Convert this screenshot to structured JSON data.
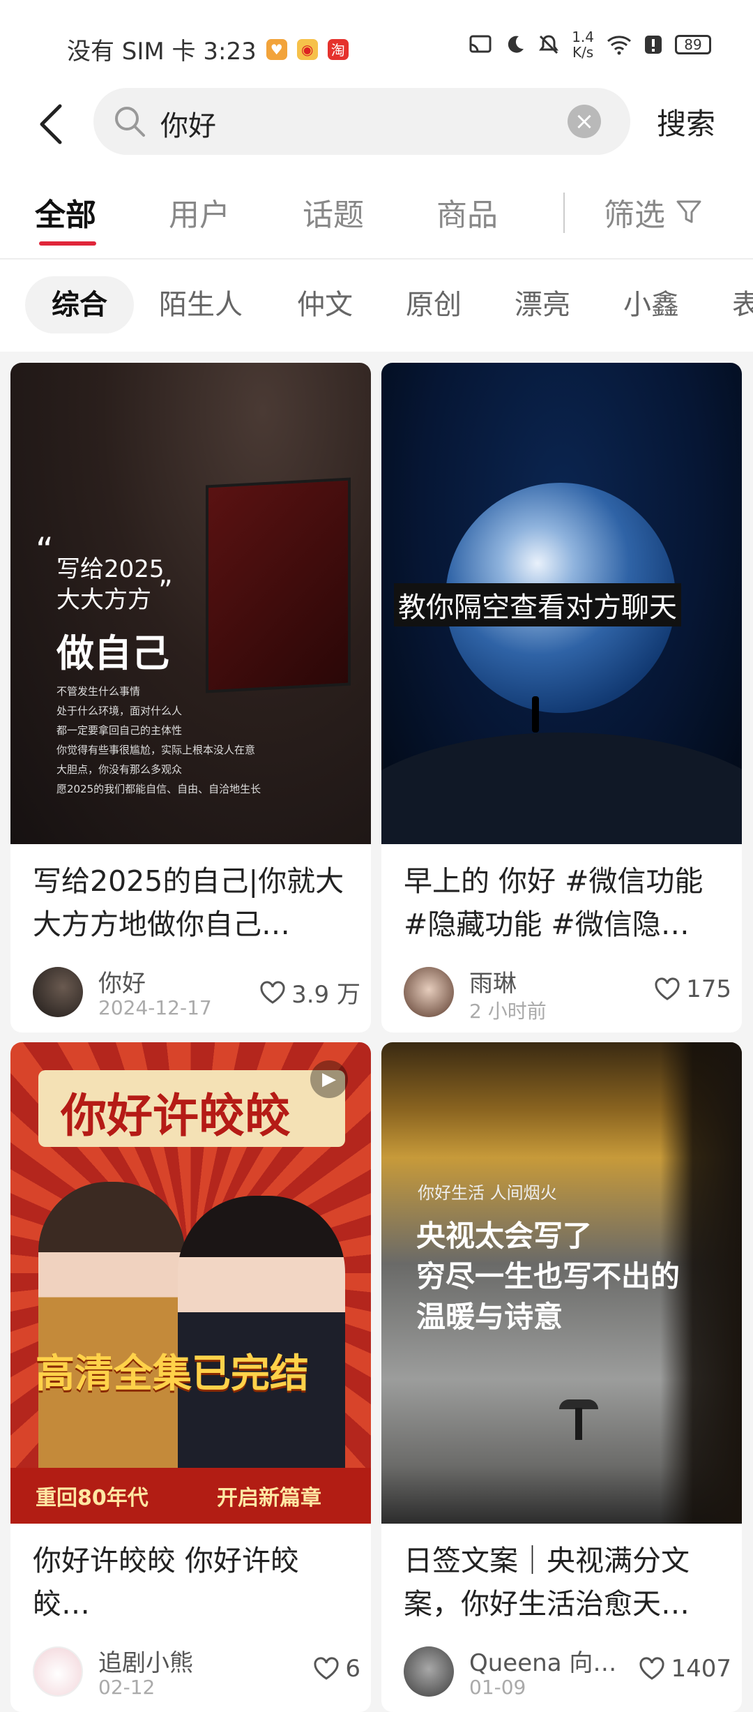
{
  "status_bar": {
    "carrier_time": "没有 SIM 卡 3:23",
    "apps": [
      "淘"
    ],
    "net_speed_top": "1.4",
    "net_speed_bottom": "K/s",
    "battery": "89"
  },
  "search": {
    "query": "你好",
    "button_label": "搜索"
  },
  "tabs": [
    "全部",
    "用户",
    "话题",
    "商品"
  ],
  "filter_label": "筛选",
  "chips": [
    "综合",
    "陌生人",
    "仲文",
    "原创",
    "漂亮",
    "小鑫",
    "表"
  ],
  "cards": [
    {
      "title": "写给2025的自己|你就大大方方地做你自己…",
      "author": "你好",
      "date": "2024-12-17",
      "likes": "3.9 万",
      "cover_lines": [
        "写给2025",
        "大大方方",
        "做自己",
        "不管发生什么事情",
        "处于什么环境，面对什么人",
        "都一定要拿回自己的主体性",
        "你觉得有些事很尴尬，实际上根本没人在意",
        "大胆点，你没有那么多观众",
        "愿2025的我们都能自信、自由、自洽地生长"
      ]
    },
    {
      "title": "早上的 你好 #微信功能 #隐藏功能 #微信隐…",
      "author": "雨琳",
      "date": "2 小时前",
      "likes": "175",
      "cover_lines": [
        "教你隔空查看对方聊天"
      ]
    },
    {
      "title": "你好许皎皎 你好许皎皎…",
      "author": "追剧小熊",
      "date": "02-12",
      "likes": "6",
      "cover_lines": [
        "你好许皎皎",
        "高清全集已完结",
        "重回80年代",
        "开启新篇章"
      ]
    },
    {
      "title": "日签文案｜央视满分文案，你好生活治愈天…",
      "author": "Queena 向…",
      "date": "01-09",
      "likes": "1407",
      "cover_lines": [
        "你好生活 人间烟火",
        "央视太会写了",
        "穷尽一生也写不出的",
        "温暖与诗意"
      ]
    }
  ],
  "colors": {
    "accent": "#e0263a",
    "background": "#f4f4f4"
  }
}
